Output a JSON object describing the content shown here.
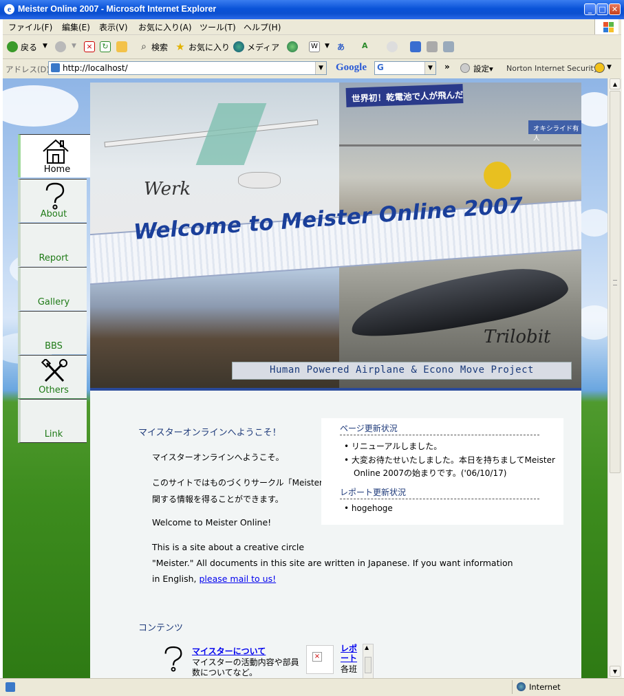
{
  "window": {
    "title": "Meister Online 2007 - Microsoft Internet Explorer"
  },
  "menu": [
    "ファイル(F)",
    "編集(E)",
    "表示(V)",
    "お気に入り(A)",
    "ツール(T)",
    "ヘルプ(H)"
  ],
  "toolbar": {
    "back": "戻る",
    "search": "検索",
    "favorites": "お気に入り",
    "media": "メディア",
    "settings": "設定▾",
    "norton": "Norton Internet Security"
  },
  "address": {
    "label": "アドレス(D)",
    "url": "http://localhost/"
  },
  "google": {
    "logo": "Google"
  },
  "nav": [
    {
      "label": "Home",
      "icon": "house-icon",
      "active": true
    },
    {
      "label": "About",
      "icon": "question-icon",
      "active": false
    },
    {
      "label": "Report",
      "icon": "",
      "active": false
    },
    {
      "label": "Gallery",
      "icon": "",
      "active": false
    },
    {
      "label": "BBS",
      "icon": "",
      "active": false
    },
    {
      "label": "Others",
      "icon": "tools-icon",
      "active": false
    },
    {
      "label": "Link",
      "icon": "",
      "active": false
    }
  ],
  "banner": {
    "welcome": "Welcome to Meister Online 2007",
    "subtitle": "Human Powered Airplane & Econo Move Project",
    "werk": "Werk",
    "trilobit": "Trilobit",
    "sign": "世界初！乾電池で人が飛んだ",
    "sign2": "オキシライド有人"
  },
  "main": {
    "heading": "マイスターオンラインへようこそ！",
    "p1": "マイスターオンラインへようこそ。",
    "p2a": "このサイトではものづくりサークル「Meister」に",
    "p2b": "関する情報を得ることができます。",
    "en1": "Welcome to Meister Online!",
    "en2a": "This is a site about a creative circle",
    "en2b": "\"Meister.\" All documents in this site are written in Japanese. If you want information",
    "en2c": "in English,",
    "en_link": "please mail to us!",
    "contents_heading": "コンテンツ",
    "item1_title": "マイスターについて",
    "item1_desc1": "マイスターの活動内容や部員",
    "item1_desc2": "数についてなど。",
    "item2_title1": "レポ",
    "item2_title2": "ート",
    "item2_desc": "各班"
  },
  "updates": {
    "page_heading": "ページ更新状況",
    "page_items": [
      "リニューアルしました。",
      "大変お待たせいたしました。本日を持ちましてMeister",
      "Online 2007の始まりです。('06/10/17)"
    ],
    "report_heading": "レポート更新状況",
    "report_items": [
      "hogehoge"
    ]
  },
  "status": {
    "zone": "Internet"
  }
}
